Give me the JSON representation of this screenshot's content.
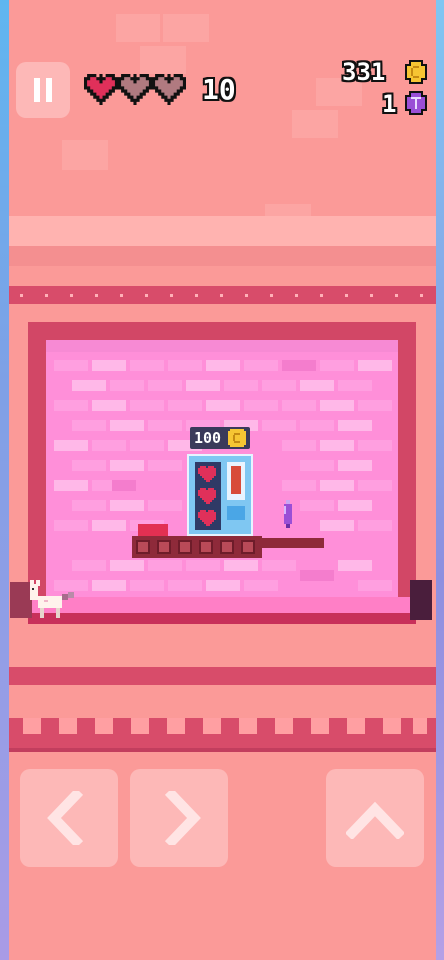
{
  "hud": {
    "pause_icon": "pause-icon",
    "hearts": [
      {
        "state": "full",
        "color": "#e0305a"
      },
      {
        "state": "empty",
        "color": "#b07a80"
      },
      {
        "state": "empty",
        "color": "#b07a80"
      }
    ],
    "score": "10",
    "coins": "331",
    "coin_icon": "coin-icon",
    "gems": "1",
    "gem_icon": "gem-icon"
  },
  "shop": {
    "price": "100",
    "price_icon": "coin-icon",
    "item": "heart-vending-machine",
    "hearts_in_stock": 3
  },
  "controls": {
    "left_icon": "chevron-left-icon",
    "right_icon": "chevron-right-icon",
    "jump_icon": "chevron-up-icon"
  },
  "colors": {
    "background": "#fb9a98",
    "wall_pink": "#ff8fd9",
    "rail": "#d84c6a",
    "heart_full": "#e0305a",
    "coin": "#f6c533",
    "gem": "#9a4fd6"
  }
}
